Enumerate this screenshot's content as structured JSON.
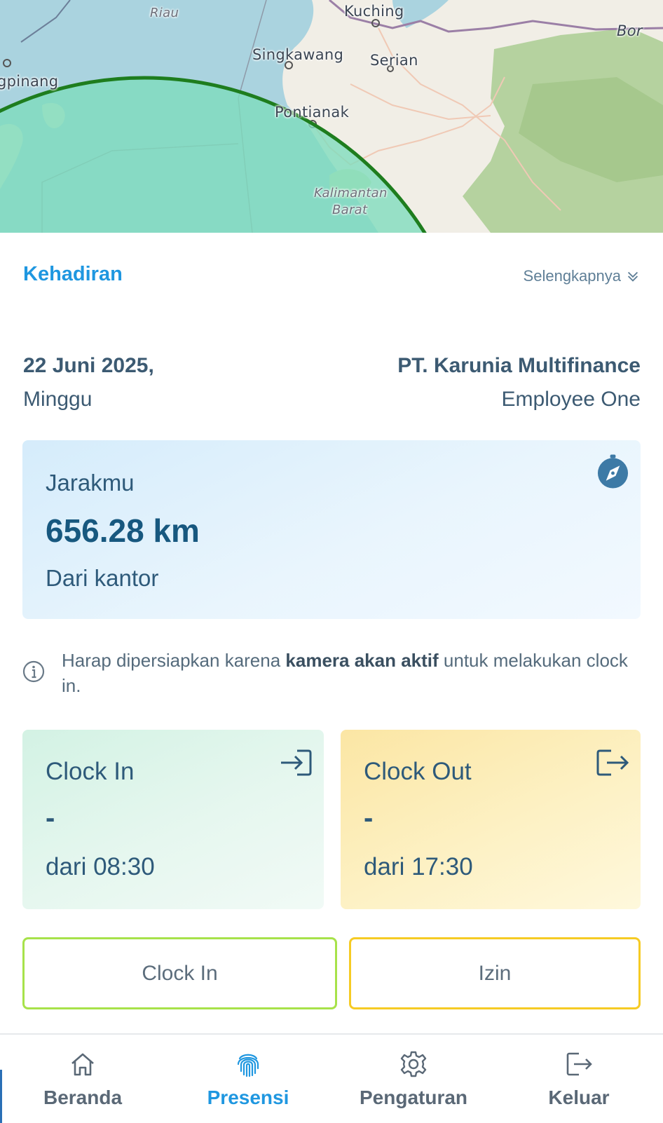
{
  "map": {
    "labels": [
      "Kuching",
      "Singkawang",
      "Serian",
      "Pontianak",
      "Kalimantan",
      "Barat",
      "gpinang",
      "Riau",
      "Bor"
    ],
    "radius_color": "#1e7d1e",
    "fill_color": "#7ddcbd"
  },
  "attendance": {
    "section_title": "Kehadiran",
    "more_label": "Selengkapnya",
    "date": "22 Juni 2025,",
    "day": "Minggu",
    "company": "PT. Karunia Multifinance",
    "employee": "Employee One"
  },
  "distance": {
    "label": "Jarakmu",
    "value": "656.28 km",
    "sub": "Dari kantor",
    "icon": "compass-icon"
  },
  "info": {
    "prefix": "Harap dipersiapkan karena ",
    "bold": "kamera akan aktif",
    "suffix": " untuk melakukan clock in.",
    "icon": "info-icon"
  },
  "clock_in": {
    "title": "Clock In",
    "value": "-",
    "from": "dari 08:30",
    "icon": "login-icon"
  },
  "clock_out": {
    "title": "Clock Out",
    "value": "-",
    "from": "dari 17:30",
    "icon": "logout-icon"
  },
  "actions": {
    "clock_in_label": "Clock In",
    "izin_label": "Izin"
  },
  "nav": {
    "items": [
      {
        "label": "Beranda",
        "icon": "home-icon"
      },
      {
        "label": "Presensi",
        "icon": "fingerprint-icon",
        "active": true
      },
      {
        "label": "Pengaturan",
        "icon": "gear-icon"
      },
      {
        "label": "Keluar",
        "icon": "logout-icon"
      }
    ]
  },
  "colors": {
    "accent": "#1f97e0",
    "text": "#3c5a72",
    "clock_in_border": "#a7e24a",
    "izin_border": "#f6cb24"
  }
}
